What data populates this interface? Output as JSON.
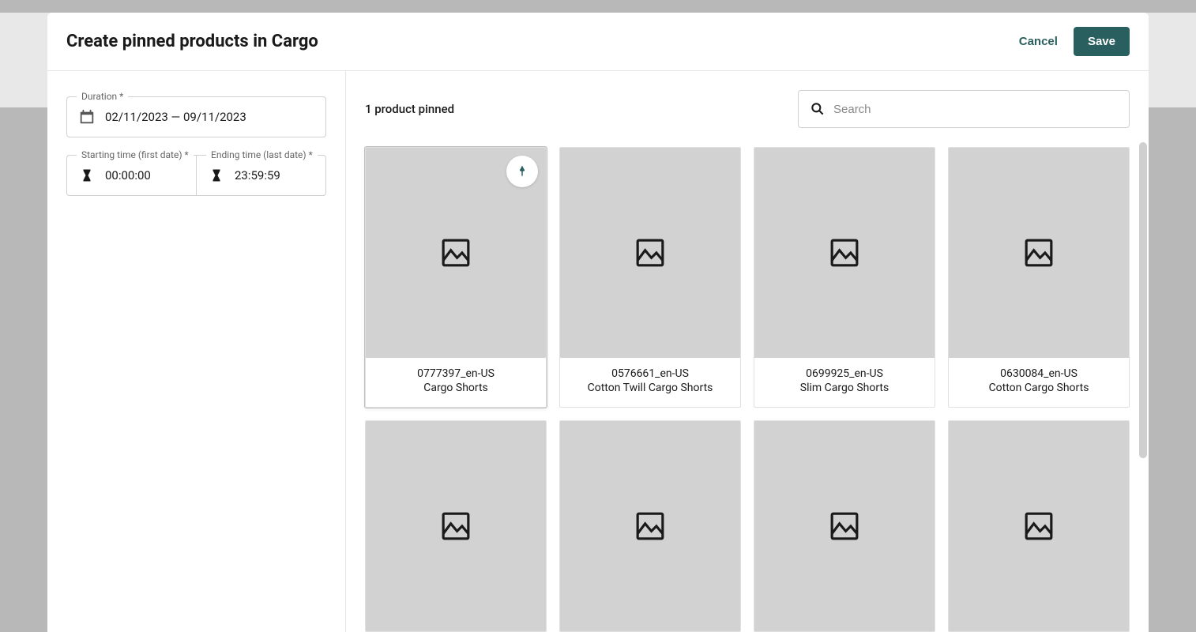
{
  "modal": {
    "title": "Create pinned products in Cargo",
    "cancel_label": "Cancel",
    "save_label": "Save"
  },
  "sidebar": {
    "duration_label": "Duration *",
    "duration_value": "02/11/2023 — 09/11/2023",
    "start_time_label": "Starting time (first date) *",
    "start_time_value": "00:00:00",
    "end_time_label": "Ending time (last date) *",
    "end_time_value": "23:59:59"
  },
  "main": {
    "pinned_count_text": "1 product pinned",
    "search_placeholder": "Search"
  },
  "products": [
    {
      "sku": "0777397_en-US",
      "name": "Cargo Shorts",
      "pinned": true
    },
    {
      "sku": "0576661_en-US",
      "name": "Cotton Twill Cargo Shorts",
      "pinned": false
    },
    {
      "sku": "0699925_en-US",
      "name": "Slim Cargo Shorts",
      "pinned": false
    },
    {
      "sku": "0630084_en-US",
      "name": "Cotton Cargo Shorts",
      "pinned": false
    },
    {
      "sku": "",
      "name": "",
      "pinned": false
    },
    {
      "sku": "",
      "name": "",
      "pinned": false
    },
    {
      "sku": "",
      "name": "",
      "pinned": false
    },
    {
      "sku": "",
      "name": "",
      "pinned": false
    }
  ],
  "colors": {
    "primary": "#2a5f5f"
  }
}
